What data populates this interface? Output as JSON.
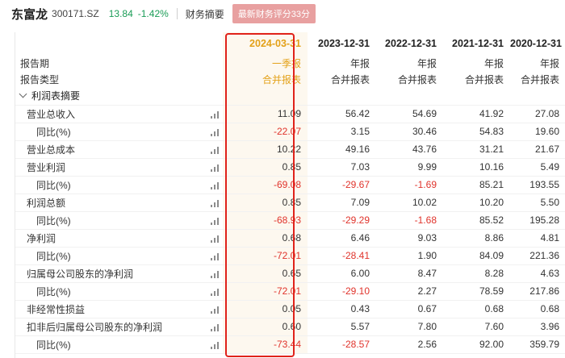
{
  "header": {
    "stock_name": "东富龙",
    "stock_code": "300171.SZ",
    "price": "13.84",
    "change": "-1.42%",
    "active_tab": "财务摘要",
    "score_badge": "最新财务评分33分"
  },
  "table": {
    "periods": [
      "2024-03-31",
      "2023-12-31",
      "2022-12-31",
      "2021-12-31",
      "2020-12-31"
    ],
    "label_period": "报告期",
    "label_type": "报告类型",
    "report_periods": [
      "一季报",
      "年报",
      "年报",
      "年报",
      "年报"
    ],
    "report_types": [
      "合并报表",
      "合并报表",
      "合并报表",
      "合并报表",
      "合并报表"
    ],
    "section_title": "利润表摘要",
    "rows": [
      {
        "label": "营业总收入",
        "values": [
          "11.09",
          "56.42",
          "54.69",
          "41.92",
          "27.08"
        ]
      },
      {
        "label": "同比(%)",
        "values": [
          "-22.07",
          "3.15",
          "30.46",
          "54.83",
          "19.60"
        ]
      },
      {
        "label": "营业总成本",
        "values": [
          "10.22",
          "49.16",
          "43.76",
          "31.21",
          "21.67"
        ]
      },
      {
        "label": "营业利润",
        "values": [
          "0.85",
          "7.03",
          "9.99",
          "10.16",
          "5.49"
        ]
      },
      {
        "label": "同比(%)",
        "values": [
          "-69.08",
          "-29.67",
          "-1.69",
          "85.21",
          "193.55"
        ]
      },
      {
        "label": "利润总额",
        "values": [
          "0.85",
          "7.09",
          "10.02",
          "10.20",
          "5.50"
        ]
      },
      {
        "label": "同比(%)",
        "values": [
          "-68.93",
          "-29.29",
          "-1.68",
          "85.52",
          "195.28"
        ]
      },
      {
        "label": "净利润",
        "values": [
          "0.68",
          "6.46",
          "9.03",
          "8.86",
          "4.81"
        ]
      },
      {
        "label": "同比(%)",
        "values": [
          "-72.01",
          "-28.41",
          "1.90",
          "84.09",
          "221.36"
        ]
      },
      {
        "label": "归属母公司股东的净利润",
        "values": [
          "0.65",
          "6.00",
          "8.47",
          "8.28",
          "4.63"
        ]
      },
      {
        "label": "同比(%)",
        "values": [
          "-72.01",
          "-29.10",
          "2.27",
          "78.59",
          "217.86"
        ]
      },
      {
        "label": "非经常性损益",
        "values": [
          "0.05",
          "0.43",
          "0.67",
          "0.68",
          "0.68"
        ]
      },
      {
        "label": "扣非后归属母公司股东的净利润",
        "values": [
          "0.60",
          "5.57",
          "7.80",
          "7.60",
          "3.96"
        ]
      },
      {
        "label": "同比(%)",
        "values": [
          "-73.44",
          "-28.57",
          "2.56",
          "92.00",
          "359.79"
        ]
      }
    ]
  },
  "colors": {
    "highlight": "#e3a118",
    "negative": "#e0332b",
    "positive_change": "#1a9c56",
    "box_border": "#e0221b"
  }
}
